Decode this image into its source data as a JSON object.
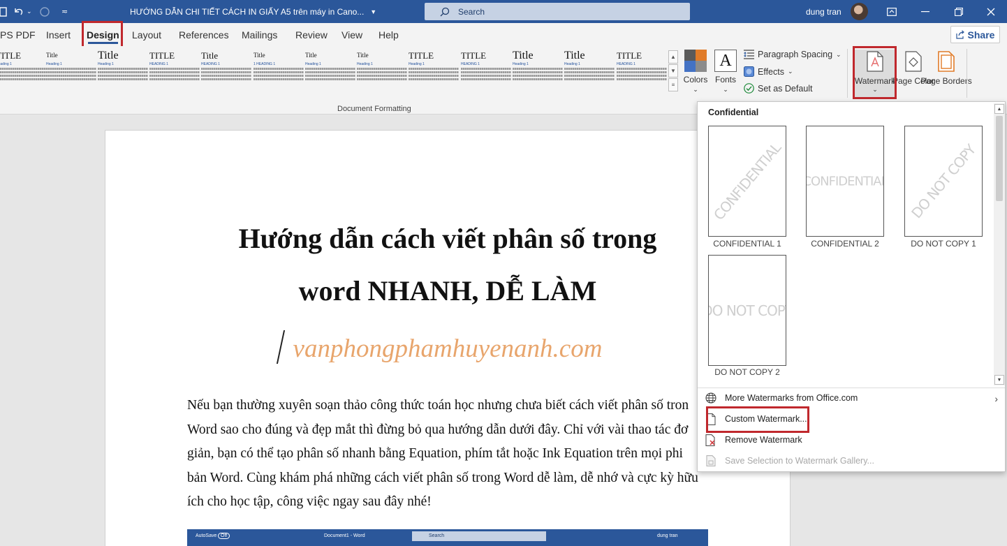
{
  "titlebar": {
    "doc_title": "HƯỚNG DẪN CHI TIẾT CÁCH IN GIẤY A5 trên máy in Cano...",
    "search_placeholder": "Search",
    "user_name": "dung tran"
  },
  "tabs": [
    "PS PDF",
    "Insert",
    "Design",
    "Layout",
    "References",
    "Mailings",
    "Review",
    "View",
    "Help"
  ],
  "active_tab": "Design",
  "share_label": "Share",
  "ribbon": {
    "styles": [
      {
        "title": "TITLE",
        "heading": "Heading 1"
      },
      {
        "title": "Title",
        "heading": "Heading 1"
      },
      {
        "title": "Title",
        "heading": "Heading 1"
      },
      {
        "title": "TITLE",
        "heading": "HEADING 1"
      },
      {
        "title": "Title",
        "heading": "HEADING 1"
      },
      {
        "title": "Title",
        "heading": "1 HEADING 1"
      },
      {
        "title": "Title",
        "heading": "Heading 1"
      },
      {
        "title": "Title",
        "heading": "Heading 1"
      },
      {
        "title": "TITLE",
        "heading": "Heading 1"
      },
      {
        "title": "TITLE",
        "heading": "HEADING 1"
      },
      {
        "title": "Title",
        "heading": "Heading 1"
      },
      {
        "title": "Title",
        "heading": "Heading 1"
      },
      {
        "title": "TITLE",
        "heading": "HEADING 1"
      }
    ],
    "group_label": "Document Formatting",
    "colors_label": "Colors",
    "fonts_label": "Fonts",
    "fonts_glyph": "A",
    "paragraph_spacing": "Paragraph Spacing",
    "effects": "Effects",
    "set_as_default": "Set as Default",
    "watermark": "Watermark",
    "page_color": "Page Color",
    "page_borders": "Page Borders"
  },
  "document": {
    "title_line1": "Hướng dẫn cách viết phân số trong",
    "title_line2": "word NHANH, DỄ LÀM",
    "site": "vanphongphamhuyenanh.com",
    "paragraph_lines": [
      "Nếu bạn thường xuyên soạn thảo công thức toán học nhưng chưa biết cách viết phân số tron",
      "Word sao cho đúng và đẹp mắt thì đừng bỏ qua hướng dẫn dưới đây. Chỉ với vài thao tác đơ",
      "giản, bạn có thể tạo phân số nhanh bằng Equation, phím tắt hoặc Ink Equation trên mọi phi",
      "bản Word. Cùng khám phá những cách viết phân số trong Word dễ làm, dễ nhớ và cực kỳ hữu",
      "ích cho học tập, công việc ngay sau đây nhé!"
    ],
    "embedded_bar": {
      "autosave": "AutoSave",
      "off": "Off",
      "doc": "Document1 - Word",
      "search": "Search",
      "user": "dung tran"
    }
  },
  "watermark_menu": {
    "header": "Confidential",
    "items": [
      {
        "caption": "CONFIDENTIAL 1",
        "text": "CONFIDENTIAL",
        "style": "diagonal"
      },
      {
        "caption": "CONFIDENTIAL 2",
        "text": "CONFIDENTIAL",
        "style": "horizontal"
      },
      {
        "caption": "DO NOT COPY 1",
        "text": "DO NOT COPY",
        "style": "diagonal"
      },
      {
        "caption": "DO NOT COPY 2",
        "text": "DO NOT COPY",
        "style": "horizontal"
      }
    ],
    "more": "More Watermarks from Office.com",
    "custom": "Custom Watermark...",
    "remove": "Remove Watermark",
    "save_selection": "Save Selection to Watermark Gallery..."
  },
  "colors": {
    "title_bar": "#2b579a",
    "highlight_red": "#c0282d",
    "site_text": "#e8a56c"
  }
}
